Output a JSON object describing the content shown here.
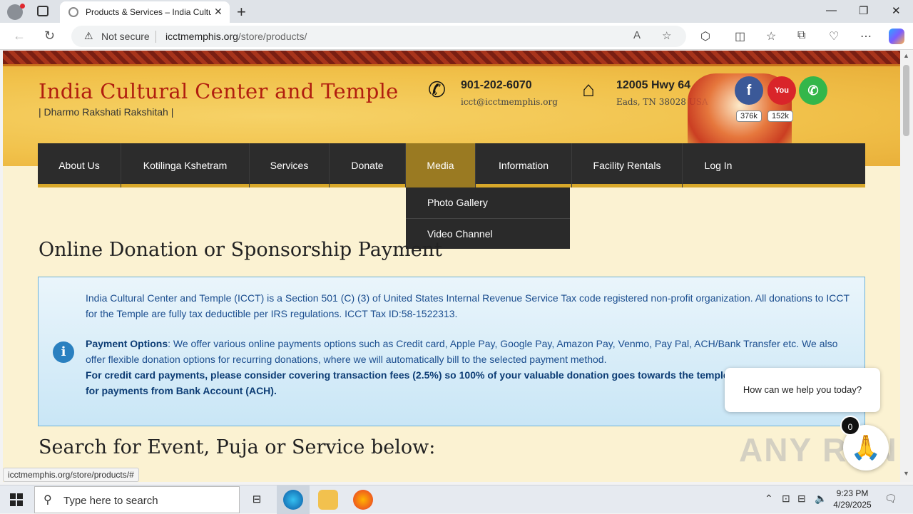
{
  "browser": {
    "tab_title": "Products & Services – India Cultu",
    "new_tab_symbol": "+",
    "address": {
      "warning": "Not secure",
      "domain": "icctmemphis.org",
      "path": "/store/products/"
    },
    "status_url": "icctmemphis.org/store/products/#"
  },
  "site": {
    "title": "India Cultural Center and Temple",
    "tagline": "| Dharmo Rakshati Rakshitah |",
    "phone": "901-202-6070",
    "email": "icct@icctmemphis.org",
    "address_line1": "12005 Hwy 64",
    "address_line2": "Eads, TN 38028 USA",
    "social": {
      "facebook_count": "376k",
      "youtube_label": "You Tube",
      "youtube_count": "152k"
    }
  },
  "nav": {
    "items": [
      {
        "label": "About Us"
      },
      {
        "label": "Kotilinga Kshetram"
      },
      {
        "label": "Services"
      },
      {
        "label": "Donate"
      },
      {
        "label": "Media"
      },
      {
        "label": "Information"
      },
      {
        "label": "Facility Rentals"
      },
      {
        "label": "Log In"
      }
    ],
    "active": "Media",
    "dropdown": [
      {
        "label": "Photo Gallery"
      },
      {
        "label": "Video Channel"
      }
    ]
  },
  "main": {
    "heading": "Online Donation or Sponsorship Payment",
    "info_para1": "India Cultural Center and Temple (ICCT) is a Section 501 (C) (3) of United States Internal Revenue Service Tax code registered non-profit organization. All donations to ICCT for the Temple are fully tax deductible per IRS regulations. ICCT Tax ID:58-1522313.",
    "payment_label": "Payment Options",
    "payment_text": ": We offer various online payments options such as Credit card, Apple Pay, Google Pay, Amazon Pay, Venmo, Pay Pal, ACH/Bank Transfer etc. We also offer flexible donation options for recurring donations, where we will automatically bill to the selected payment method.",
    "payment_bold": "For credit card payments, please consider covering transaction fees (2.5%) so 100% of your valuable donation goes towards the temple. Th",
    "payment_bold2": "for payments from Bank Account (ACH).",
    "search_heading": "Search for Event, Puja or Service below:"
  },
  "chat": {
    "prompt": "How can we help you today?",
    "badge": "0"
  },
  "watermark": "ANY RUN",
  "taskbar": {
    "search_placeholder": "Type here to search",
    "time": "9:23 PM",
    "date": "4/29/2025"
  },
  "colors": {
    "title_red": "#b11e0f",
    "nav_bg": "#2c2c2c",
    "nav_active": "#9a7a22",
    "info_text": "#1b4e8f"
  }
}
